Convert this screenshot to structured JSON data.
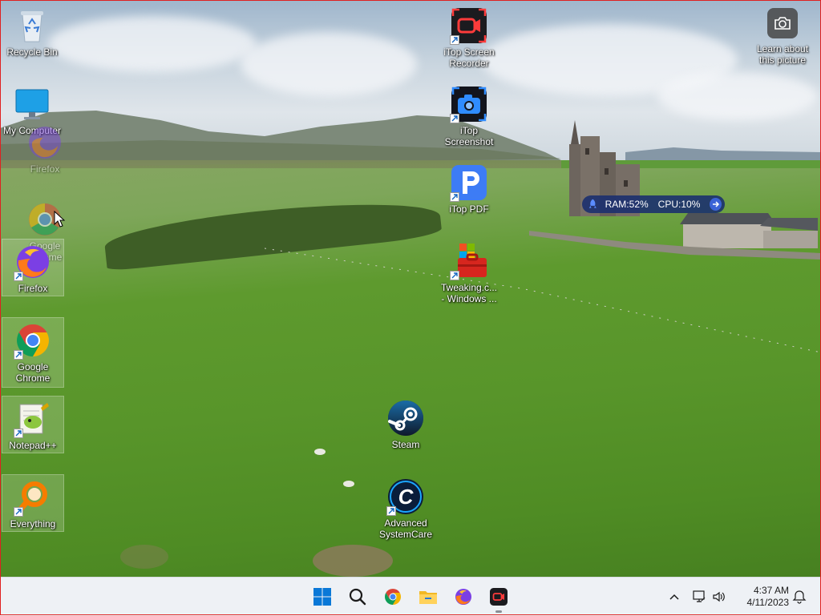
{
  "desktop": {
    "icons_left": [
      {
        "id": "recycle-bin",
        "label": "Recycle Bin"
      },
      {
        "id": "my-computer",
        "label": "My Computer"
      },
      {
        "id": "firefox",
        "label": "Firefox"
      },
      {
        "id": "google-chrome",
        "label": "Google Chrome"
      },
      {
        "id": "notepad-pp",
        "label": "Notepad++"
      },
      {
        "id": "everything",
        "label": "Everything"
      }
    ],
    "ghost_labels": {
      "firefox_ghost": "Firefox",
      "chrome_ghost": "Google Chrome"
    },
    "icons_center": [
      {
        "id": "itop-screen-recorder",
        "label": "iTop Screen Recorder"
      },
      {
        "id": "itop-screenshot",
        "label": "iTop Screenshot"
      },
      {
        "id": "itop-pdf",
        "label": "iTop PDF"
      },
      {
        "id": "tweaking",
        "label": "Tweaking.c... - Windows ..."
      },
      {
        "id": "steam",
        "label": "Steam"
      },
      {
        "id": "advanced-systemcare",
        "label": "Advanced SystemCare"
      }
    ],
    "learn_about": {
      "label": "Learn about this picture"
    }
  },
  "widget": {
    "ram": "RAM:52%",
    "cpu": "CPU:10%"
  },
  "taskbar": {
    "pinned": [
      "Start",
      "Search",
      "Google Chrome",
      "File Explorer",
      "Firefox",
      "iTop Screen Recorder"
    ],
    "clock": {
      "time": "4:37 AM",
      "date": "4/11/2023"
    }
  },
  "colors": {
    "taskbar_bg": "#eef1f5",
    "widget_bg": "#1c2f6e",
    "accent": "#0078d4"
  }
}
